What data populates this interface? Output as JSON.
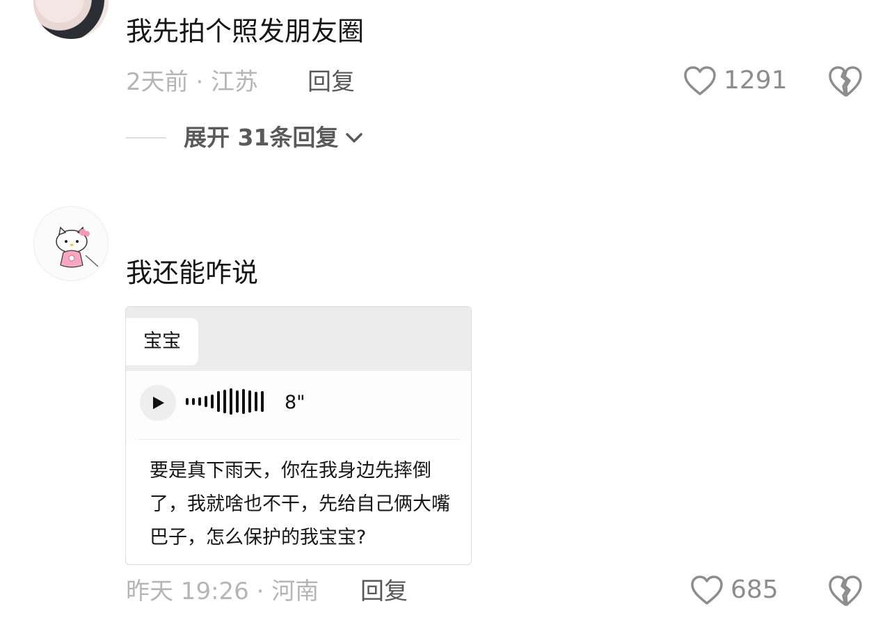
{
  "comments": [
    {
      "text": "我先拍个照发朋友圈",
      "meta": "2天前 · 江苏",
      "reply_label": "回复",
      "likes": "1291",
      "expand_label": "展开 31条回复"
    },
    {
      "text": "我还能咋说",
      "meta": "昨天 19:26 · 河南",
      "reply_label": "回复",
      "likes": "685",
      "quote_card": {
        "name": "宝宝",
        "voice_duration": "8\"",
        "body": "要是真下雨天，你在我身边先摔倒了，我就啥也不干，先给自己俩大嘴巴子，怎么保护的我宝宝?"
      }
    }
  ],
  "colors": {
    "text": "#161616",
    "meta": "#b5b5b5",
    "reply": "#585858",
    "like_count": "#8d8d8d",
    "card_header": "#ececec"
  },
  "icons": [
    "heart-icon",
    "dislike-broken-heart-icon",
    "chevron-down-icon",
    "play-icon",
    "waveform-icon",
    "hello-kitty-avatar"
  ]
}
